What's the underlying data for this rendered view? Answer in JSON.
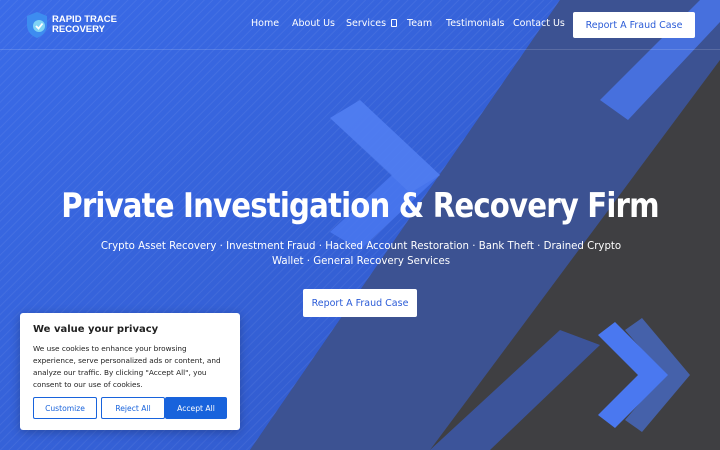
{
  "brand": {
    "name_line1": "RAPID TRACE",
    "name_line2": "RECOVERY",
    "logo_color": "#3d8cf0"
  },
  "nav": {
    "items": [
      "Home",
      "About Us",
      "Services",
      "Team",
      "Testimonials",
      "Contact Us"
    ],
    "cta": "Report A Fraud Case"
  },
  "hero": {
    "title": "Private Investigation & Recovery Firm",
    "subtitle": "Crypto Asset Recovery · Investment Fraud · Hacked Account Restoration · Bank Theft · Drained Crypto Wallet · General Recovery Services",
    "cta": "Report A Fraud Case"
  },
  "cookie": {
    "title": "We value your privacy",
    "text": "We use cookies to enhance your browsing experience, serve personalized ads or content, and analyze our traffic. By clicking \"Accept All\", you consent to our use of cookies.",
    "customize": "Customize",
    "reject": "Reject All",
    "accept": "Accept All"
  },
  "colors": {
    "accent": "#3b6cf0",
    "dark_bg": "#3f3f42",
    "button_text": "#2a5bd7",
    "cookie_button": "#1863dc"
  }
}
